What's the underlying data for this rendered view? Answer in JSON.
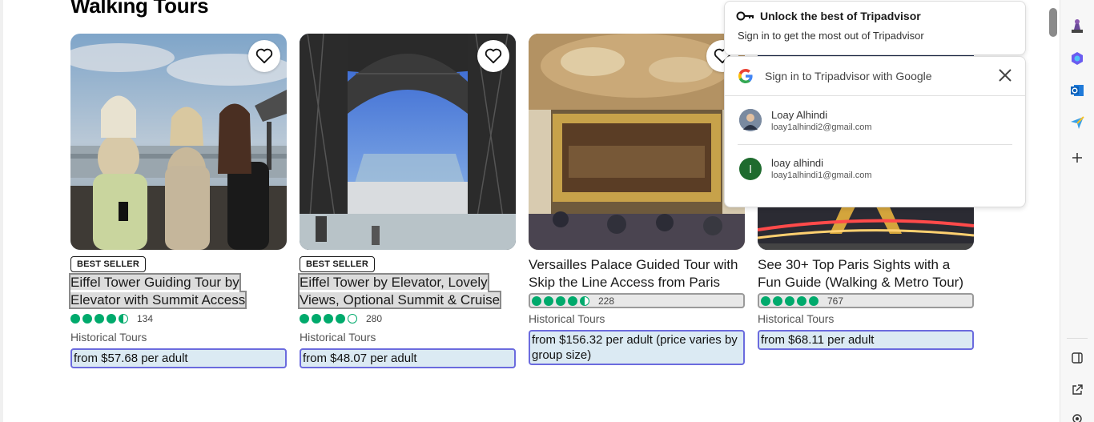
{
  "section": {
    "title": "Walking Tours"
  },
  "cards": [
    {
      "badge": "BEST SELLER",
      "title": "Eiffel Tower Guiding Tour by Elevator with Summit Access",
      "rating": 4.5,
      "review_count": "134",
      "category": "Historical Tours",
      "price": "from $57.68 per adult"
    },
    {
      "badge": "BEST SELLER",
      "title": "Eiffel Tower by Elevator, Lovely Views, Optional Summit & Cruise",
      "rating": 4.0,
      "review_count": "280",
      "category": "Historical Tours",
      "price": "from $48.07 per adult"
    },
    {
      "badge": "",
      "title": "Versailles Palace Guided Tour with Skip the Line Access from Paris",
      "rating": 4.5,
      "review_count": "228",
      "category": "Historical Tours",
      "price": "from $156.32 per adult (price varies by group size)"
    },
    {
      "badge": "",
      "title": "See 30+ Top Paris Sights with a Fun Guide (Walking & Metro Tour)",
      "rating": 5.0,
      "review_count": "767",
      "category": "Historical Tours",
      "price": "from $68.11 per adult"
    }
  ],
  "signin_banner": {
    "title": "Unlock the best of Tripadvisor",
    "subtitle": "Sign in to get the most out of Tripadvisor"
  },
  "google_popup": {
    "header": "Sign in to Tripadvisor with Google",
    "accounts": [
      {
        "name": "Loay Alhindi",
        "email": "loay1alhindi2@gmail.com",
        "avatar": "photo"
      },
      {
        "name": "loay alhindi",
        "email": "loay1alhindi1@gmail.com",
        "avatar_letter": "l",
        "avatar_color": "#1e6b2e"
      }
    ]
  },
  "colors": {
    "bubble": "#00aa6c",
    "price_bg": "#dbeaf3",
    "price_border": "#6b6bde"
  }
}
